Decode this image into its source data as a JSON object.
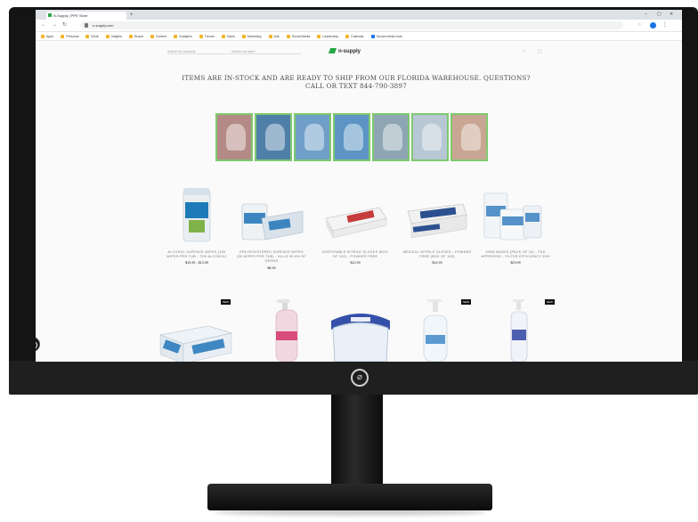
{
  "browser": {
    "tab_title": "N-Supply | PPE Store",
    "new_tab": "+",
    "url": "n-supply.com",
    "window_controls": [
      "–",
      "▢",
      "✕"
    ],
    "nav": [
      "←",
      "→",
      "↻"
    ],
    "bookmarks": [
      "Apps",
      "Personal",
      "Work",
      "Insights",
      "Brand",
      "Content",
      "Analytics",
      "Trends",
      "Sales",
      "Marketing",
      "Ads",
      "Social Media",
      "Leadership",
      "Calendar",
      "Social media tools"
    ]
  },
  "site": {
    "logo_text": "n-supply",
    "search_placeholder": "Search for products",
    "search_hint": "Search our store",
    "header_icons": "♡ ⬚"
  },
  "headline": "ITEMS ARE IN-STOCK AND ARE READY TO SHIP FROM OUR FLORIDA WAREHOUSE. QUESTIONS? CALL OR TEXT 844-790-3897",
  "image_strip_colors": [
    "#b48a86",
    "#4f7fa8",
    "#6f9fc8",
    "#5c95c5",
    "#8ea6b4",
    "#b7c7d4",
    "#c9a693"
  ],
  "products_row1": [
    {
      "name": "ALCOHOL SURFACE WIPES (100 WIPES PER TUB - 75% ALCOHOL)",
      "price": "$10.99 - $13.99",
      "colors": {
        "primary": "#e9eef2",
        "accent": "#1e7ab8"
      }
    },
    {
      "name": "EPA REGISTERED SURFACE WIPES (50 WIPES PER TUB) - KILLS 99.9% OF GERMS",
      "price": "$8.99",
      "colors": {
        "primary": "#eef2f5",
        "accent": "#3d85c0"
      }
    },
    {
      "name": "DISPOSABLE NITRILE GLOVES (BOX OF 100) - POWDER FREE",
      "price": "$12.99",
      "colors": {
        "primary": "#f4f4f4",
        "accent": "#c63b3b"
      }
    },
    {
      "name": "MEDICAL NITRILE GLOVES - POWDER FREE (BOX OF 100)",
      "price": "$14.99",
      "colors": {
        "primary": "#f1f1f1",
        "accent": "#2c4f8f"
      }
    },
    {
      "name": "KN95 MASKS (PACK OF 10) - FDA APPROVED - FILTER EFFICIENCY 95%",
      "price": "$29.99",
      "colors": {
        "primary": "#f2f5f8",
        "accent": "#5592c9"
      }
    }
  ],
  "products_row2": [
    {
      "badge": "NEW"
    },
    {
      "badge": ""
    },
    {
      "badge": ""
    },
    {
      "badge": "NEW"
    },
    {
      "badge": "NEW"
    }
  ]
}
